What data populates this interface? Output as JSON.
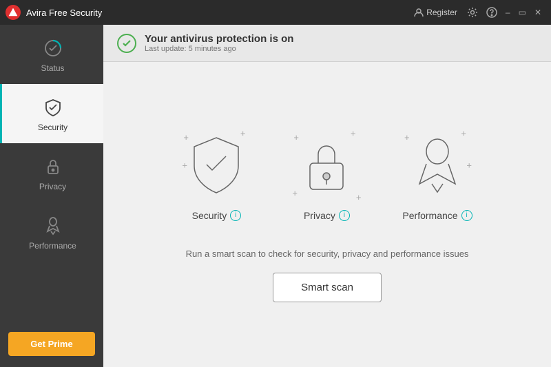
{
  "titleBar": {
    "appName": "Avira  Free Security",
    "registerLabel": "Register",
    "settingsTitle": "Settings",
    "helpTitle": "Help",
    "minimizeTitle": "Minimize",
    "maximizeTitle": "Maximize",
    "closeTitle": "Close"
  },
  "sidebar": {
    "items": [
      {
        "id": "status",
        "label": "Status",
        "active": false
      },
      {
        "id": "security",
        "label": "Security",
        "active": true
      },
      {
        "id": "privacy",
        "label": "Privacy",
        "active": false
      },
      {
        "id": "performance",
        "label": "Performance",
        "active": false
      }
    ],
    "getPrimeLabel": "Get Prime"
  },
  "statusBar": {
    "title": "Your antivirus protection is on",
    "subtitle": "Last update: 5 minutes ago"
  },
  "features": [
    {
      "id": "security",
      "label": "Security"
    },
    {
      "id": "privacy",
      "label": "Privacy"
    },
    {
      "id": "performance",
      "label": "Performance"
    }
  ],
  "scanSection": {
    "description": "Run a smart scan to check for security, privacy and performance issues",
    "buttonLabel": "Smart scan"
  }
}
